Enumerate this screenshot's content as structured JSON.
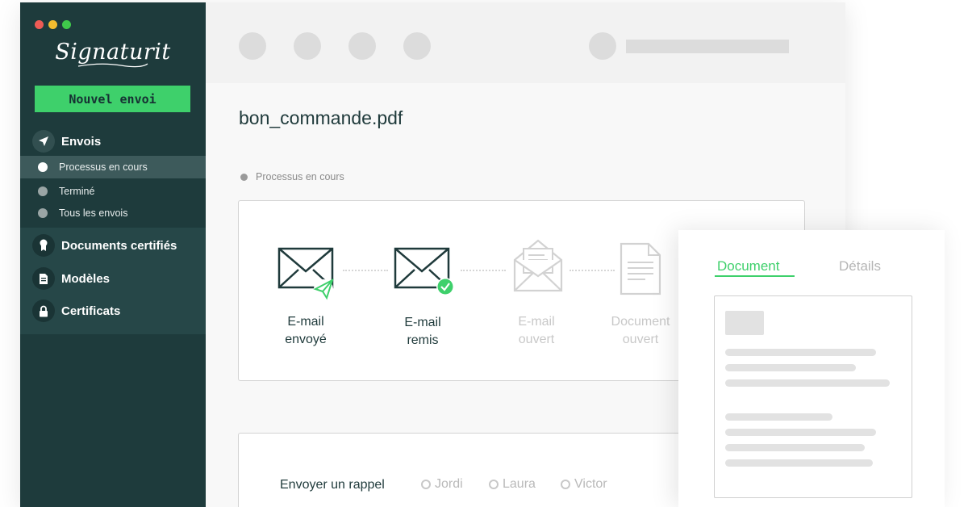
{
  "window": {
    "traffic_lights": [
      "#ee5b55",
      "#f2bc2f",
      "#3fc94b"
    ]
  },
  "sidebar": {
    "logo": "Signaturit",
    "new_send_label": "Nouvel envoi",
    "accent": "#3ed06b",
    "background": "#1e3b3c",
    "main_item": {
      "label": "Envois",
      "icon": "paper-plane-icon"
    },
    "sub_items": [
      {
        "label": "Processus en cours",
        "active": true
      },
      {
        "label": "Terminé",
        "active": false
      },
      {
        "label": "Tous les envois",
        "active": false
      }
    ],
    "sections": [
      {
        "label": "Documents certifiés",
        "icon": "certified-ribbon-icon"
      },
      {
        "label": "Modèles",
        "icon": "document-icon"
      },
      {
        "label": "Certificats",
        "icon": "lock-icon"
      }
    ]
  },
  "main": {
    "document_title": "bon_commande.pdf",
    "status": "Processus en cours",
    "steps": [
      {
        "line1": "E-mail",
        "line2": "envoyé",
        "state": "done",
        "icon": "envelope-sent-icon"
      },
      {
        "line1": "E-mail",
        "line2": "remis",
        "state": "done",
        "icon": "envelope-delivered-icon"
      },
      {
        "line1": "E-mail",
        "line2": "ouvert",
        "state": "pending",
        "icon": "envelope-open-icon"
      },
      {
        "line1": "Document",
        "line2": "ouvert",
        "state": "pending",
        "icon": "document-icon"
      }
    ],
    "reminder": {
      "label": "Envoyer un rappel",
      "recipients": [
        "Jordi",
        "Laura",
        "Victor"
      ]
    }
  },
  "panel": {
    "tabs": [
      {
        "label": "Document",
        "active": true
      },
      {
        "label": "Détails",
        "active": false
      }
    ]
  }
}
